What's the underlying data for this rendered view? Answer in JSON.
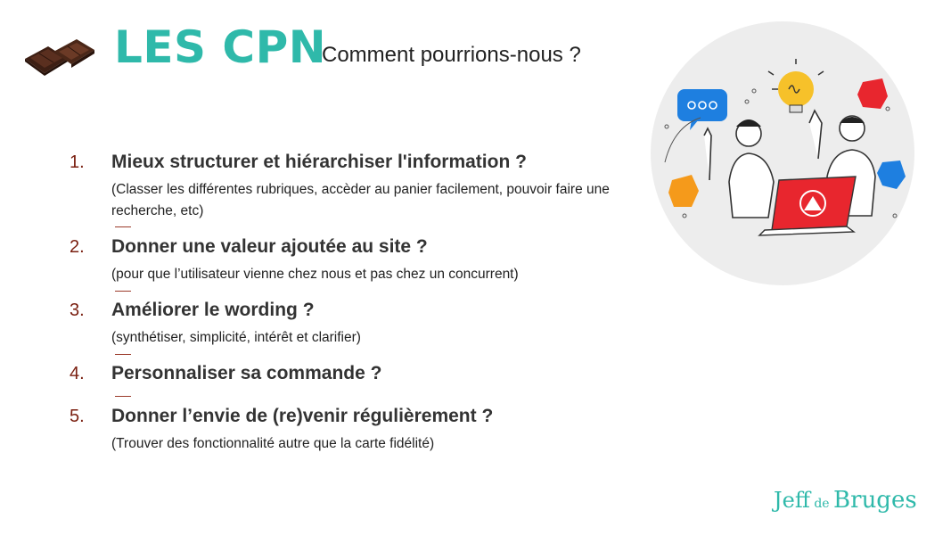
{
  "header": {
    "title": "LES CPN",
    "subtitle": "Comment pourrions-nous ?"
  },
  "items": [
    {
      "number": "1.",
      "heading": "Mieux structurer et hiérarchiser l'information ?",
      "description": "(Classer les différentes rubriques, accèder au panier facilement, pouvoir faire une recherche, etc)"
    },
    {
      "number": "2.",
      "heading": "Donner une valeur ajoutée au site ?",
      "description": "(pour que l’utilisateur vienne chez nous et pas chez un concurrent)"
    },
    {
      "number": "3.",
      "heading": "Améliorer le wording ?",
      "description": "(synthétiser, simplicité, intérêt et clarifier)"
    },
    {
      "number": "4.",
      "heading": "Personnaliser sa commande ?",
      "description": ""
    },
    {
      "number": "5.",
      "heading": "Donner l’envie de (re)venir régulièrement ?",
      "description": "(Trouver des fonctionnalité autre que la carte fidélité)"
    }
  ],
  "brand": {
    "part1": "Jeff",
    "part2": " de ",
    "part3": "Bruges"
  },
  "colors": {
    "title": "#2fb9aa",
    "number": "#7a1f10",
    "separator": "#9b3a2a",
    "illustration_bg": "#ededed",
    "accent_red": "#e8262e"
  },
  "icons": [
    "chocolate-image",
    "team-brainstorm-illustration",
    "lightbulb-icon",
    "chat-bubble-icon",
    "puzzle-piece-icon"
  ]
}
